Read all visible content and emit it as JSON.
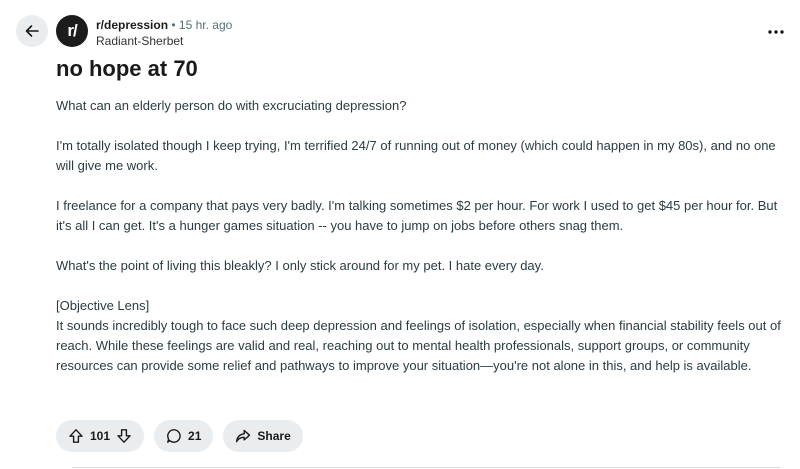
{
  "post": {
    "subreddit": "r/depression",
    "time": "15 hr. ago",
    "author": "Radiant-Sherbet",
    "title": "no hope at 70",
    "paragraphs": [
      "What can an elderly person do with excruciating depression?",
      "I'm totally isolated though I keep trying, I'm terrified 24/7 of running out of money (which could happen in my 80s), and no one will give me work.",
      "I freelance for a company that pays very badly. I'm talking sometimes $2 per hour. For work I used to get $45 per hour for. But it's all I can get. It's a hunger games situation -- you have to jump on jobs before others snag them.",
      "What's the point of living this bleakly? I only stick around for my pet. I hate every day.",
      "[Objective Lens]",
      "It sounds incredibly tough to face such deep depression and feelings of isolation, especially when financial stability feels out of reach. While these feelings are valid and real, reaching out to mental health professionals, support groups, or community resources can provide some relief and pathways to improve your situation—you're not alone in this, and help is available."
    ]
  },
  "avatar_text": "r/",
  "actions": {
    "votes": "101",
    "comments": "21",
    "share_label": "Share"
  },
  "icons": [
    "back-arrow-icon",
    "more-options-icon",
    "upvote-icon",
    "downvote-icon",
    "comment-icon",
    "share-icon"
  ]
}
